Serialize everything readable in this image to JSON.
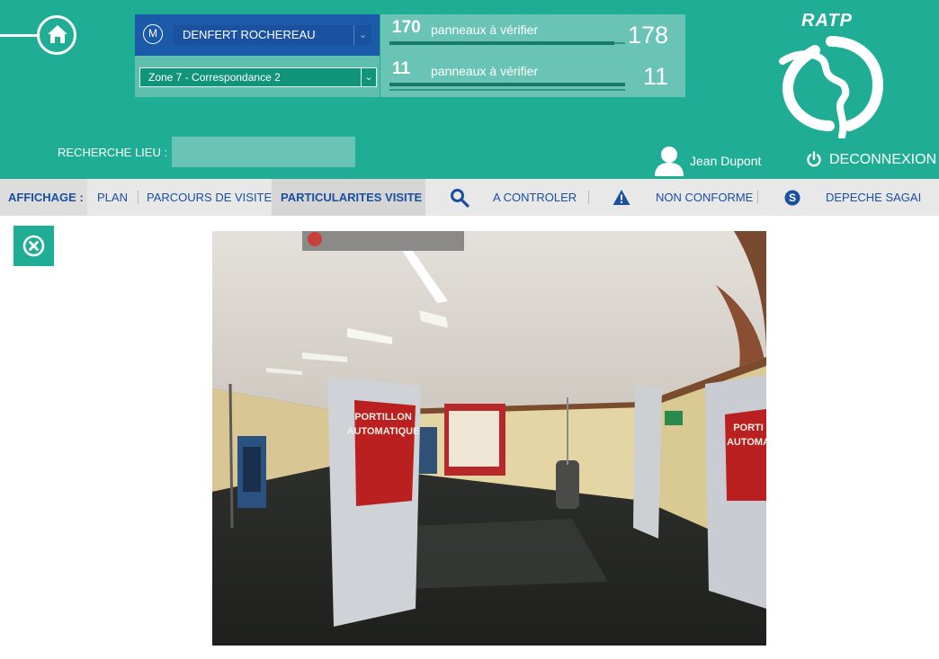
{
  "header": {
    "home_icon": "home-icon",
    "station": {
      "icon": "metro-icon",
      "metro_symbol": "M",
      "name": "DENFERT ROCHEREAU"
    },
    "zone": {
      "selected": "Zone 7 - Correspondance 2"
    },
    "counters": [
      {
        "count": "170",
        "label": "panneaux à vérifier",
        "total": "178",
        "progress": 0.955
      },
      {
        "count": "11",
        "label": "panneaux à vérifier",
        "total": "11",
        "progress": 1.0
      }
    ],
    "brand": "RATP",
    "search": {
      "label": "RECHERCHE LIEU :",
      "placeholder": "",
      "value": ""
    },
    "user": {
      "name": "Jean Dupont",
      "icon": "user-icon"
    },
    "logout": {
      "label": "DECONNEXION",
      "icon": "power-icon"
    }
  },
  "nav": {
    "affichage": "AFFICHAGE :",
    "items": [
      "PLAN",
      "PARCOURS DE VISITE",
      "PARTICULARITES VISITE"
    ],
    "active": "PARTICULARITES VISITE",
    "actions": [
      {
        "label": "A CONTROLER",
        "icon": "search-icon"
      },
      {
        "label": "NON CONFORME",
        "icon": "warning-icon"
      },
      {
        "label": "DEPECHE SAGAI",
        "icon": "s-circle-icon"
      }
    ]
  },
  "content": {
    "close_icon": "close-circle-icon",
    "photo_signs": {
      "left_sign": [
        "PORTILLON",
        "AUTOMATIQUE"
      ],
      "right_sign": [
        "PORTI",
        "AUTOMA"
      ]
    }
  },
  "colors": {
    "primary_green": "#1fae95",
    "panel_green": "#6ac4b5",
    "ratp_blue": "#1b5aa8",
    "nav_text": "#1b4fa0",
    "nav_bg": "#e8e8e8"
  }
}
